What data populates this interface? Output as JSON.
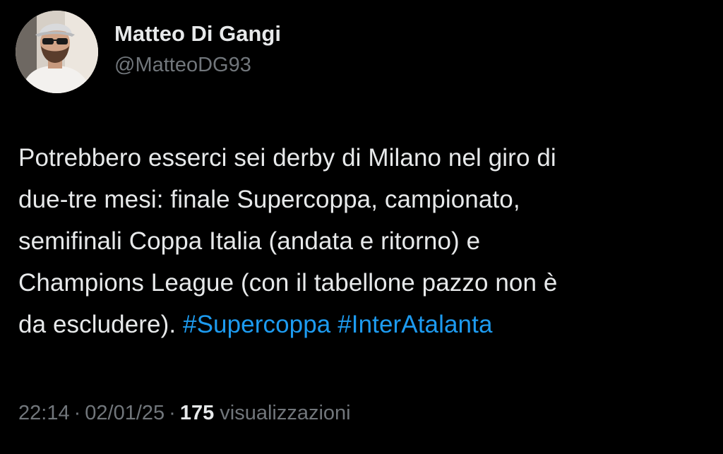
{
  "author": {
    "display_name": "Matteo Di Gangi",
    "handle": "@MatteoDG93",
    "avatar_icon": "profile-photo"
  },
  "tweet": {
    "lines": [
      "Potrebbero esserci sei derby di Milano nel giro di",
      "due-tre mesi: finale Supercoppa, campionato,",
      "semifinali Coppa Italia (andata e ritorno) e",
      "Champions League (con il tabellone pazzo non è"
    ],
    "last_line_text": "da escludere).",
    "hashtags": [
      "#Supercoppa",
      "#InterAtalanta"
    ]
  },
  "meta": {
    "time": "22:14",
    "date": "02/01/25",
    "separator": "·",
    "views_count": "175",
    "views_label": "visualizzazioni"
  },
  "colors": {
    "background": "#000000",
    "primary_text": "#e7e9ea",
    "secondary_text": "#71767b",
    "link": "#1d9bf0"
  }
}
